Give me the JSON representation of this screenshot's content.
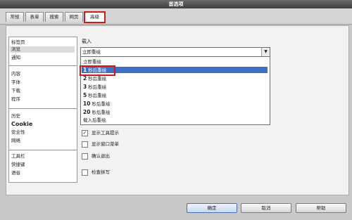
{
  "window": {
    "title": "首选项"
  },
  "tabs": [
    {
      "label": "常规"
    },
    {
      "label": "表单"
    },
    {
      "label": "搜索"
    },
    {
      "label": "网页"
    },
    {
      "label": "高级"
    }
  ],
  "sidebar": {
    "items": [
      {
        "label": "标签页"
      },
      {
        "label": "浏览"
      },
      {
        "label": "通知"
      },
      {
        "label": "内容"
      },
      {
        "label": "字体"
      },
      {
        "label": "下载"
      },
      {
        "label": "程序"
      },
      {
        "label": "历史"
      },
      {
        "label": "Cookie"
      },
      {
        "label": "安全性"
      },
      {
        "label": "网络"
      },
      {
        "label": "工具栏"
      },
      {
        "label": "快捷键"
      },
      {
        "label": "语音"
      }
    ]
  },
  "main": {
    "section_label": "载入",
    "combo_value": "立即重绘",
    "combo_arrow": "▼",
    "dropdown_options": [
      {
        "num": "",
        "text": "立即重绘"
      },
      {
        "num": "1",
        "text": "秒后重绘"
      },
      {
        "num": "2",
        "text": "秒后重绘"
      },
      {
        "num": "3",
        "text": "秒后重绘"
      },
      {
        "num": "5",
        "text": "秒后重绘"
      },
      {
        "num": "10",
        "text": "秒后重绘"
      },
      {
        "num": "20",
        "text": "秒后重绘"
      },
      {
        "num": "",
        "text": "载入后重绘"
      }
    ],
    "checkboxes": [
      {
        "label": "显示工具提示",
        "mark": "✓"
      },
      {
        "label": "显示窗口菜单",
        "mark": ""
      },
      {
        "label": "确认退出",
        "mark": ""
      },
      {
        "label": "检查拼写",
        "mark": ""
      }
    ]
  },
  "buttons": {
    "ok": "确定",
    "cancel": "取消",
    "help": "帮助"
  },
  "colors": {
    "highlight": "#3d6fc2",
    "annotation": "#d01a1a"
  }
}
